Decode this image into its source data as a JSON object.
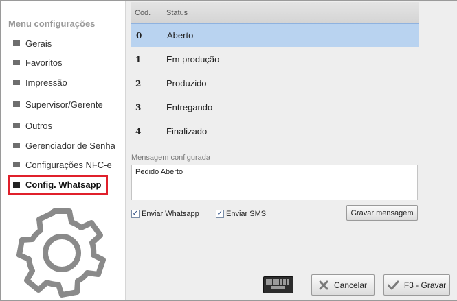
{
  "sidebar": {
    "title": "Menu configurações",
    "items": [
      {
        "label": "Gerais"
      },
      {
        "label": "Favoritos"
      },
      {
        "label": "Impressão"
      },
      {
        "label": "Supervisor/Gerente"
      },
      {
        "label": "Outros"
      },
      {
        "label": "Gerenciador de Senha"
      },
      {
        "label": "Configurações NFC-e"
      },
      {
        "label": "Config. Whatsapp",
        "active": true
      }
    ],
    "logo_icon": "gear-icon"
  },
  "table": {
    "columns": [
      "Cód.",
      "Status"
    ],
    "rows": [
      {
        "code": "0",
        "status": "Aberto",
        "selected": true
      },
      {
        "code": "1",
        "status": "Em produção"
      },
      {
        "code": "2",
        "status": "Produzido"
      },
      {
        "code": "3",
        "status": "Entregando"
      },
      {
        "code": "4",
        "status": "Finalizado"
      }
    ]
  },
  "message": {
    "label": "Mensagem configurada",
    "value": "Pedido Aberto"
  },
  "options": {
    "whatsapp_label": "Enviar Whatsapp",
    "whatsapp_checked": true,
    "sms_label": "Enviar SMS",
    "sms_checked": true
  },
  "buttons": {
    "save_message": "Gravar mensagem",
    "cancel": "Cancelar",
    "save": "F3 - Gravar",
    "keyboard_icon": "keyboard-icon"
  },
  "colors": {
    "highlight": "#e0202b",
    "selected_row": "#b9d3f0"
  }
}
